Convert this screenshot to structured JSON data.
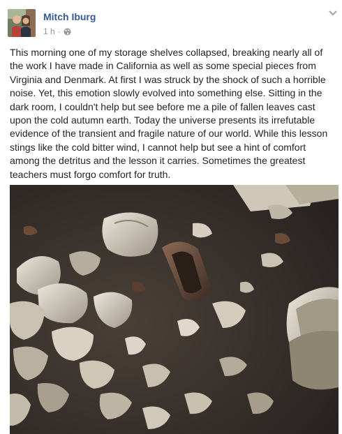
{
  "post": {
    "author": "Mitch Iburg",
    "timestamp": "1 h",
    "separator": "·",
    "privacy_icon": "globe-icon",
    "menu_icon": "chevron-down-icon",
    "text": "This morning one of my storage shelves collapsed, breaking nearly all of the work I have made in California as well as some special pieces from Virginia and Denmark. At first I was struck by the shock of such a horrible noise. Yet, this emotion slowly evolved into something else. Sitting in the dark room, I couldn't help but see before me a pile of fallen leaves cast upon the cold autumn earth. Today the universe presents its irrefutable evidence of the transient and fragile nature of our world. While this lesson stings like the cold bitter wind, I cannot help but see a hint of comfort among the detritus and the lesson it carries. Sometimes the greatest teachers must forgo comfort for truth."
  },
  "colors": {
    "author_link": "#365899",
    "meta_text": "#90949c",
    "body_text": "#1d2129",
    "carpet": "#3a332d",
    "shard_light": "#d8d2c4",
    "shard_dark": "#6b4a38"
  }
}
